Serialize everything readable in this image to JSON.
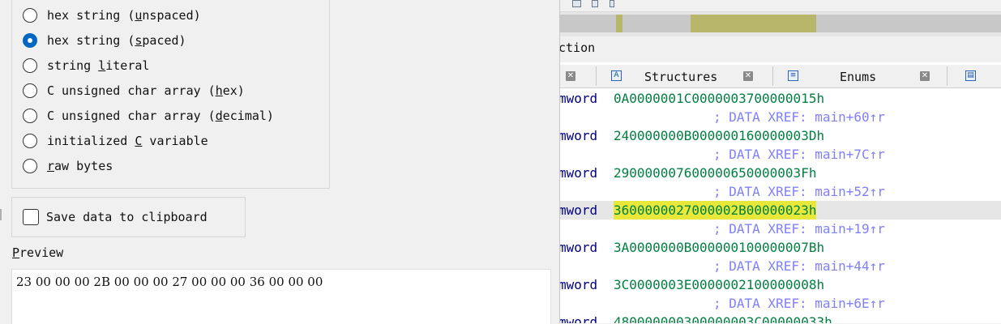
{
  "dialog": {
    "format_options": [
      {
        "pre": "hex string (",
        "acc": "u",
        "post": "nspaced)",
        "checked": false
      },
      {
        "pre": "hex string (",
        "acc": "s",
        "post": "paced)",
        "checked": true
      },
      {
        "pre": "string ",
        "acc": "l",
        "post": "iteral",
        "checked": false
      },
      {
        "pre": "C unsigned char array (",
        "acc": "h",
        "post": "ex)",
        "checked": false
      },
      {
        "pre": "C unsigned char array (",
        "acc": "d",
        "post": "ecimal)",
        "checked": false
      },
      {
        "pre": "initialized ",
        "acc": "C",
        "post": " variable",
        "checked": false
      },
      {
        "pre": "",
        "acc": "r",
        "post": "aw bytes",
        "checked": false
      }
    ],
    "save_clipboard": {
      "label": "Save data to clipboard",
      "checked": false
    },
    "preview": {
      "title_acc": "P",
      "title_rest": "review",
      "text": "23 00 00 00 2B 00 00 00 27 00 00 00 36 00 00 00"
    }
  },
  "ida": {
    "section_label": "ction",
    "tabs": [
      {
        "label": "",
        "icon": "",
        "close": true
      },
      {
        "label": "Structures",
        "icon": "A",
        "close": true
      },
      {
        "label": "Enums",
        "icon": "≡",
        "close": true
      },
      {
        "label": "",
        "icon": "▤",
        "close": false
      }
    ],
    "listing": [
      {
        "kind": "data",
        "kw": "mword",
        "value": "0A0000001C0000003700000015h",
        "selected": false
      },
      {
        "kind": "xref",
        "text": "; DATA XREF: main+60↑r"
      },
      {
        "kind": "data",
        "kw": "mword",
        "value": "240000000B000000160000003Dh",
        "selected": false
      },
      {
        "kind": "xref",
        "text": "; DATA XREF: main+7C↑r"
      },
      {
        "kind": "data",
        "kw": "mword",
        "value": "290000007600000650000003Fh",
        "selected": false
      },
      {
        "kind": "xref",
        "text": "; DATA XREF: main+52↑r"
      },
      {
        "kind": "data",
        "kw": "mword",
        "value": "3600000027000002B00000023h",
        "selected": true
      },
      {
        "kind": "xref",
        "text": "; DATA XREF: main+19↑r"
      },
      {
        "kind": "data",
        "kw": "mword",
        "value": "3A0000000B000000100000007Bh",
        "selected": false
      },
      {
        "kind": "xref",
        "text": "; DATA XREF: main+44↑r"
      },
      {
        "kind": "data",
        "kw": "mword",
        "value": "3C0000003E0000002100000008h",
        "selected": false
      },
      {
        "kind": "xref",
        "text": "; DATA XREF: main+6E↑r"
      },
      {
        "kind": "data",
        "kw": "mword",
        "value": "480000000300000003C00000033h",
        "selected": false
      }
    ],
    "colors": {
      "keyword": "#000080",
      "value": "#008040",
      "xref": "#8080ff",
      "highlight": "#e8e83a",
      "nav_segment": "#b8b66a"
    }
  }
}
